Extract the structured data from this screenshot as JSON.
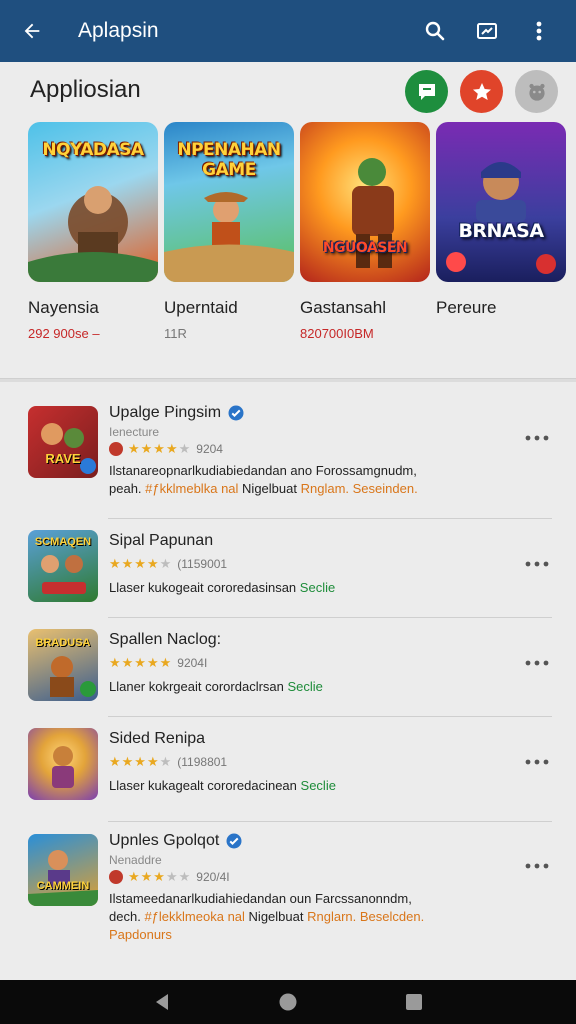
{
  "appbar": {
    "title": "Aplapsin"
  },
  "section": {
    "title": "Appliosian"
  },
  "featured": [
    {
      "title": "Nayensia",
      "subtitle": "292 900se  –",
      "art_text": "NQYADASA",
      "colors": [
        "#4ec1e8",
        "#e35b1d"
      ]
    },
    {
      "title": "Uperntaid",
      "subtitle": "11R",
      "art_text": "NPENAHAN GAME",
      "colors": [
        "#5ac05a",
        "#2a85c8"
      ]
    },
    {
      "title": "Gastansahl",
      "subtitle": "820700I0BM",
      "art_text": "NGUOASEN",
      "colors": [
        "#ff9a1f",
        "#b3241b"
      ]
    },
    {
      "title": "Pereure",
      "subtitle": "",
      "art_text": "BRNASA",
      "colors": [
        "#3b3f9e",
        "#7a2bb3"
      ]
    }
  ],
  "list": [
    {
      "name": "Upalge Pingsim",
      "verified": true,
      "developer": "Ienecture",
      "stars": 4,
      "count": "9204",
      "desc_plain": "Ilstanareopnarlkudiabiedandan ano Forossamgnudm,",
      "desc_line2_a": "peah.",
      "desc_hl1": "#ƒkklmeblka",
      "desc_hl_mid": "nal",
      "desc_hl2": "Nigelbuat",
      "desc_hl3": "Rnglam. Seseinden.",
      "icon_text": "RAVE",
      "icon_colors": [
        "#7a1e1e",
        "#c62f2f"
      ]
    },
    {
      "name": "Sipal Papunan",
      "verified": false,
      "developer": "",
      "stars": 4,
      "count": "(1159001",
      "desc_plain": "Llaser kukogeait cororedasinsan",
      "desc_green": "Seclie",
      "icon_text": "SCMAQEN",
      "icon_colors": [
        "#2f7a2f",
        "#5aa0d8"
      ]
    },
    {
      "name": "Spallen Naclog:",
      "verified": false,
      "developer": "",
      "stars": 5,
      "count": "9204I",
      "desc_plain": "Llaner kokrgeait corordaclrsan",
      "desc_green": "Seclie",
      "icon_text": "BRADUSA",
      "icon_colors": [
        "#c06a2b",
        "#3a5d8f"
      ]
    },
    {
      "name": "Sided Renipa",
      "verified": false,
      "developer": "",
      "stars": 4,
      "count": "(1198801",
      "desc_plain": "Llaser kukagealt cororedacinean",
      "desc_green": "Seclie",
      "icon_text": "",
      "icon_colors": [
        "#7b3fb0",
        "#e3a43a"
      ]
    },
    {
      "name": "Upnles Gpolqot",
      "verified": true,
      "developer": "Nenaddre",
      "stars": 3,
      "count": "920/4I",
      "desc_plain": "Ilstameedanarlkudiahiedandan oun Farcssanonndm,",
      "desc_line2_a": "dech.",
      "desc_hl1": "#ƒlekklmeoka",
      "desc_hl_mid": "nal",
      "desc_hl2": "Nigelbuat",
      "desc_hl3": "Rnglarn. Beselcden.",
      "desc_line3": "Papdonurs",
      "icon_text": "CAMMEIN",
      "icon_colors": [
        "#2a8fd8",
        "#e0a030"
      ]
    }
  ],
  "colors": {
    "appbar": "#1f4f7f",
    "badge_green": "#1e8e3e",
    "badge_red": "#e0442a",
    "badge_gray": "#bdbdbd",
    "star": "#e9a820",
    "price_red": "#c62828",
    "highlight_orange": "#d9761a",
    "highlight_green": "#1e8c3a"
  },
  "icons": {
    "back": "arrow-left-icon",
    "search": "search-icon",
    "trend": "trending-icon",
    "more": "more-vert-icon",
    "badge1": "chat-badge-icon",
    "badge2": "star-badge-icon",
    "badge3": "face-badge-icon",
    "verified": "verified-check-icon",
    "row_more": "more-horiz-icon",
    "nav_back": "nav-back-icon",
    "nav_home": "nav-home-icon",
    "nav_recent": "nav-recent-icon"
  }
}
